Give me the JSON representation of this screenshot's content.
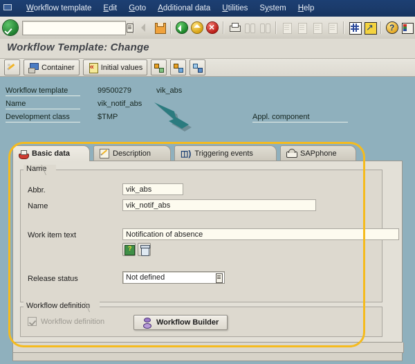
{
  "window": {
    "icon": "window-menu-icon"
  },
  "menubar": {
    "items": [
      {
        "label": "Workflow template",
        "mnemonic": "W"
      },
      {
        "label": "Edit",
        "mnemonic": "E"
      },
      {
        "label": "Goto",
        "mnemonic": "G"
      },
      {
        "label": "Additional data",
        "mnemonic": "A"
      },
      {
        "label": "Utilities",
        "mnemonic": "U"
      },
      {
        "label": "System",
        "mnemonic": "y"
      },
      {
        "label": "Help",
        "mnemonic": "H"
      }
    ]
  },
  "toolbar": {
    "ok_icon": "green-check-enter-icon",
    "command_field": {
      "value": "",
      "placeholder": "",
      "dropdown_icon": "command-field-dropdown-icon"
    },
    "buttons": [
      {
        "name": "back-icon",
        "title": "Back"
      },
      {
        "name": "save-icon",
        "title": "Save"
      },
      {
        "name": "exit-green-icon",
        "title": "Exit"
      },
      {
        "name": "cancel-yellow-icon",
        "title": "Cancel"
      },
      {
        "name": "stop-red-icon",
        "title": "Stop"
      },
      {
        "name": "print-icon",
        "title": "Print"
      },
      {
        "name": "find-icon",
        "title": "Find"
      },
      {
        "name": "find-next-icon",
        "title": "Find next"
      },
      {
        "name": "first-page-icon",
        "title": "First page"
      },
      {
        "name": "previous-page-icon",
        "title": "Previous page"
      },
      {
        "name": "next-page-icon",
        "title": "Next page"
      },
      {
        "name": "last-page-icon",
        "title": "Last page"
      },
      {
        "name": "grid-layout-icon",
        "title": "Create session"
      },
      {
        "name": "shortcut-arrow-icon",
        "title": "Create shortcut"
      },
      {
        "name": "help-icon",
        "title": "Help"
      },
      {
        "name": "layout-menu-icon",
        "title": "Customize local layout"
      }
    ]
  },
  "page": {
    "title": "Workflow Template: Change"
  },
  "app_toolbar": {
    "buttons": [
      {
        "name": "display-change-button",
        "label": "",
        "icon": "pencil-icon"
      },
      {
        "name": "container-button",
        "label": "Container",
        "icon": "container-icon"
      },
      {
        "name": "initial-values-button",
        "label": "Initial values",
        "icon": "initial-values-icon"
      },
      {
        "name": "workflow-node-button-1",
        "label": "",
        "icon": "workflow-node-icon"
      },
      {
        "name": "workflow-node-button-2",
        "label": "",
        "icon": "workflow-transfer-icon"
      },
      {
        "name": "workflow-node-button-3",
        "label": "",
        "icon": "workflow-copy-icon"
      }
    ]
  },
  "header": {
    "rows": [
      {
        "label": "Workflow template",
        "value": "99500279",
        "value2": "vik_abs"
      },
      {
        "label": "Name",
        "value": "vik_notif_abs",
        "value2": ""
      },
      {
        "label": "Development class",
        "value": "$TMP",
        "value2": ""
      }
    ],
    "appl_component_label": "Appl. component",
    "appl_component_value": ""
  },
  "annotation": {
    "arrow_color": "#2b7b7f",
    "points_to": "vik_abs"
  },
  "highlight": {
    "color": "#f5bb1e"
  },
  "tabs": [
    {
      "label": "Basic data",
      "icon": "printer-icon",
      "active": true
    },
    {
      "label": "Description",
      "icon": "pencil-note-icon",
      "active": false
    },
    {
      "label": "Triggering events",
      "icon": "signal-wave-icon",
      "active": false
    },
    {
      "label": "SAPphone",
      "icon": "telephone-icon",
      "active": false
    }
  ],
  "basic_data": {
    "name_group": {
      "title": "Name",
      "abbr": {
        "label": "Abbr.",
        "value": "vik_abs"
      },
      "name": {
        "label": "Name",
        "value": "vik_notif_abs"
      },
      "work_item_text": {
        "label": "Work item text",
        "value": "Notification of absence",
        "buttons": [
          {
            "name": "insert-variable-button",
            "icon": "variable-icon"
          },
          {
            "name": "delete-text-button",
            "icon": "trash-icon"
          }
        ]
      },
      "release_status": {
        "label": "Release status",
        "value": "Not defined",
        "dropdown_icon": "release-status-dropdown-icon"
      }
    },
    "workflow_definition_group": {
      "title": "Workflow definition",
      "checkbox": {
        "label": "Workflow definition",
        "checked": true,
        "disabled": true
      },
      "builder_button": {
        "label": "Workflow Builder",
        "icon": "workflow-builder-icon"
      }
    }
  }
}
